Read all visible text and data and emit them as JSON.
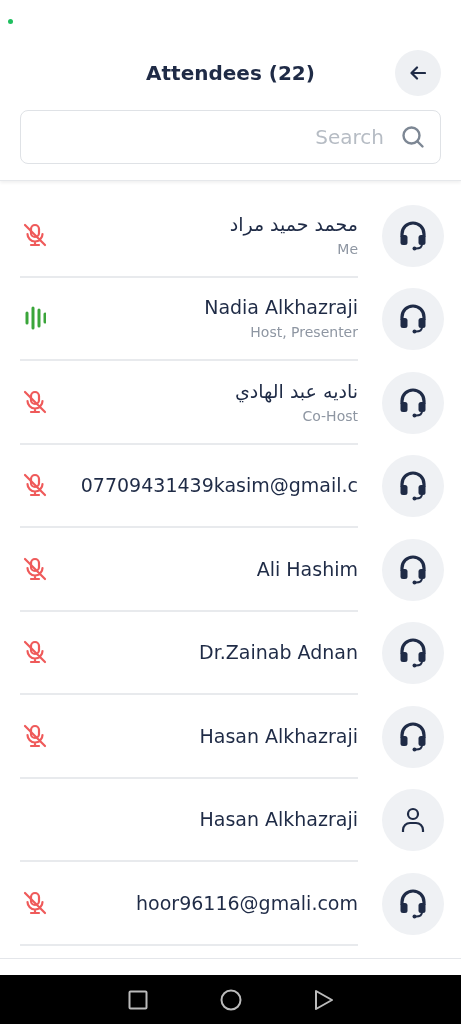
{
  "header": {
    "title": "Attendees (22)"
  },
  "search": {
    "placeholder": "Search"
  },
  "attendees": [
    {
      "name": "محمد حميد مراد",
      "role": "Me",
      "muted": true,
      "speaking": false,
      "kind": "audio"
    },
    {
      "name": "Nadia Alkhazraji",
      "role": "Host, Presenter",
      "muted": false,
      "speaking": true,
      "kind": "audio"
    },
    {
      "name": "ناديه عبد الهادي",
      "role": "Co-Host",
      "muted": true,
      "speaking": false,
      "kind": "audio"
    },
    {
      "name": "07709431439kasim@gmail.c",
      "muted": true,
      "speaking": false,
      "kind": "audio"
    },
    {
      "name": "Ali Hashim",
      "muted": true,
      "speaking": false,
      "kind": "audio"
    },
    {
      "name": "Dr.Zainab Adnan",
      "muted": true,
      "speaking": false,
      "kind": "audio"
    },
    {
      "name": "Hasan Alkhazraji",
      "muted": true,
      "speaking": false,
      "kind": "audio"
    },
    {
      "name": "Hasan Alkhazraji",
      "muted": false,
      "speaking": false,
      "kind": "user"
    },
    {
      "name": "hoor96116@gmali.com",
      "muted": true,
      "speaking": false,
      "kind": "audio"
    }
  ]
}
